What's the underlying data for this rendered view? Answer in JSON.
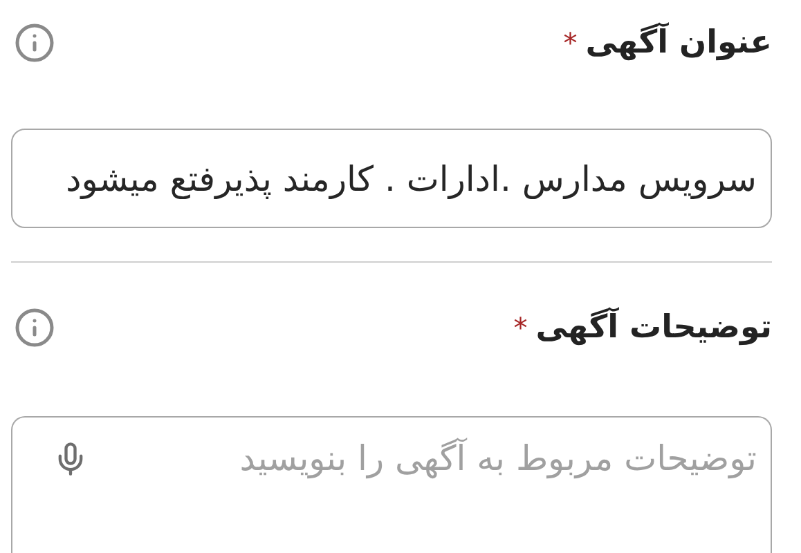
{
  "fields": [
    {
      "kind": "text",
      "label": "عنوان آگهی",
      "required": true,
      "required_mark": "*",
      "value": "سرویس مدارس .ادارات . کارمند پذیرفتع میشود"
    },
    {
      "kind": "textarea",
      "label": "توضیحات آگهی",
      "required": true,
      "required_mark": "*",
      "placeholder": "توضیحات مربوط به آگهی را بنویسید"
    }
  ]
}
